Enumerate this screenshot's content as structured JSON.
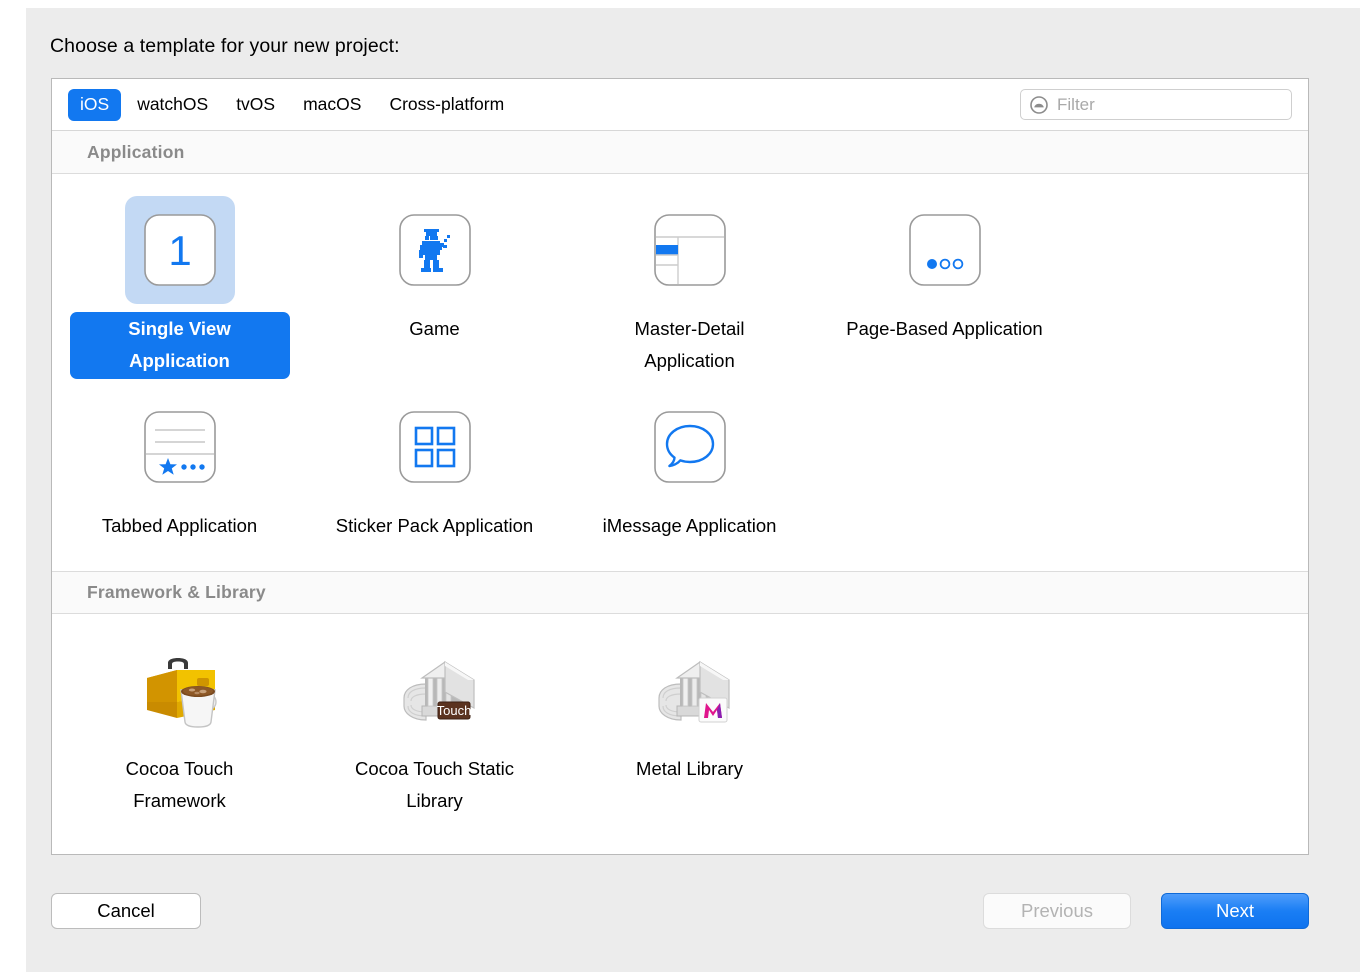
{
  "dialog": {
    "title": "Choose a template for your new project:"
  },
  "platform_tabs": {
    "items": [
      {
        "label": "iOS",
        "active": true
      },
      {
        "label": "watchOS",
        "active": false
      },
      {
        "label": "tvOS",
        "active": false
      },
      {
        "label": "macOS",
        "active": false
      },
      {
        "label": "Cross-platform",
        "active": false
      }
    ]
  },
  "filter": {
    "icon": "filter-icon",
    "placeholder": "Filter",
    "value": ""
  },
  "sections": [
    {
      "header": "Application",
      "templates": [
        {
          "label": "Single View Application",
          "icon": "single-view-icon",
          "selected": true
        },
        {
          "label": "Game",
          "icon": "game-robot-icon",
          "selected": false
        },
        {
          "label": "Master-Detail Application",
          "icon": "master-detail-icon",
          "selected": false
        },
        {
          "label": "Page-Based Application",
          "icon": "page-based-icon",
          "selected": false
        },
        {
          "label": "Tabbed Application",
          "icon": "tabbed-icon",
          "selected": false
        },
        {
          "label": "Sticker Pack Application",
          "icon": "sticker-pack-icon",
          "selected": false
        },
        {
          "label": "iMessage Application",
          "icon": "imessage-icon",
          "selected": false
        }
      ]
    },
    {
      "header": "Framework & Library",
      "templates": [
        {
          "label": "Cocoa Touch Framework",
          "icon": "toolbox-coffee-icon",
          "selected": false
        },
        {
          "label": "Cocoa Touch Static Library",
          "icon": "library-touch-icon",
          "selected": false,
          "badge": "Touch"
        },
        {
          "label": "Metal Library",
          "icon": "library-metal-icon",
          "selected": false,
          "badge": "M"
        }
      ]
    }
  ],
  "buttons": {
    "cancel": "Cancel",
    "previous": "Previous",
    "next": "Next"
  },
  "colors": {
    "accent_blue": "#1278f0",
    "selection_fill": "#c3d9f4",
    "section_header_text": "#8a8a8a",
    "disabled_text": "#b3b3b3",
    "dialog_bg": "#ececec"
  }
}
